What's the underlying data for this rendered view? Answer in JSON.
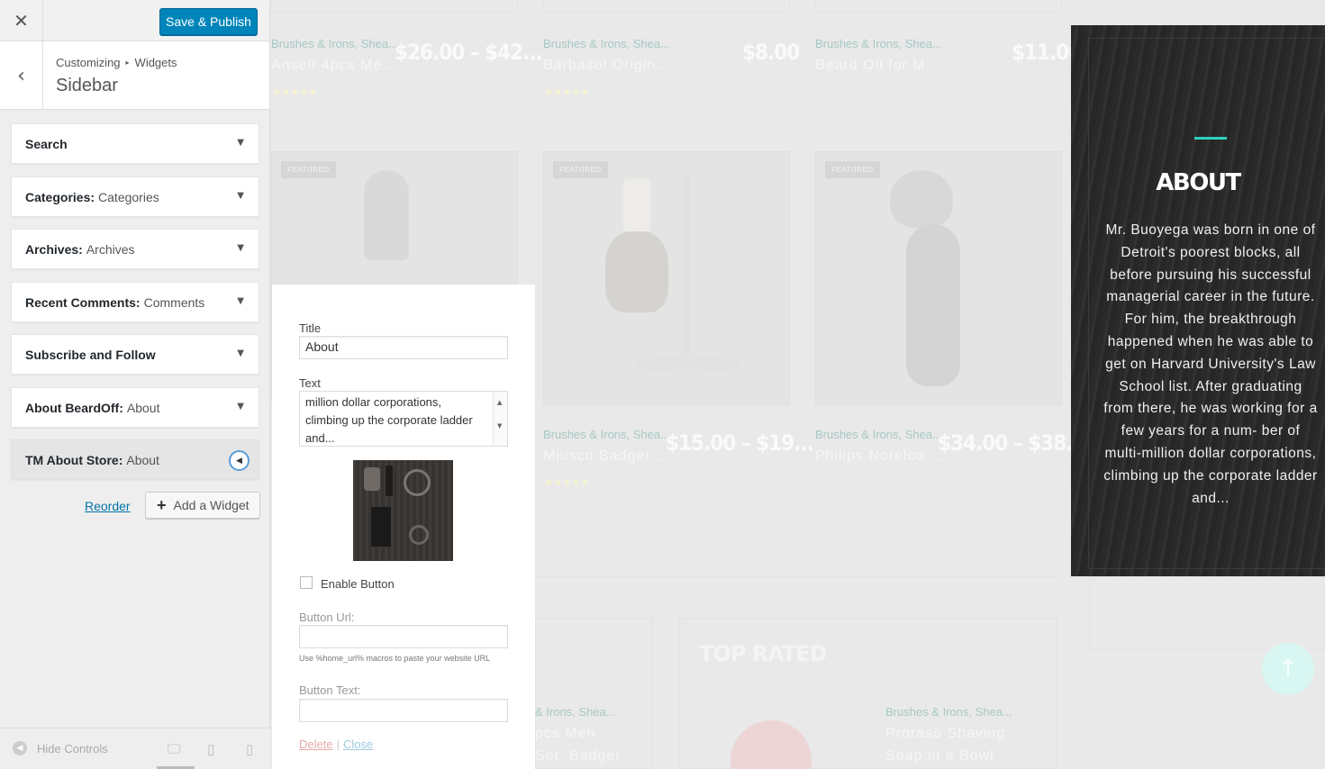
{
  "header": {
    "close_icon": "✕",
    "publish_label": "Save & Publish"
  },
  "section": {
    "back_icon": "‹",
    "crumb_root": "Customizing",
    "crumb_sep": "▸",
    "crumb_child": "Widgets",
    "title": "Sidebar"
  },
  "widgets": [
    {
      "name": "Search",
      "sub": ""
    },
    {
      "name": "Categories:",
      "sub": "Categories"
    },
    {
      "name": "Archives:",
      "sub": "Archives"
    },
    {
      "name": "Recent Comments:",
      "sub": "Comments"
    },
    {
      "name": "Subscribe and Follow",
      "sub": ""
    },
    {
      "name": "About BeardOff:",
      "sub": "About"
    },
    {
      "name": "TM About Store:",
      "sub": "About"
    }
  ],
  "actions": {
    "reorder": "Reorder",
    "add_widget": "Add a Widget"
  },
  "footer": {
    "hide_controls": "Hide Controls"
  },
  "products_row1": [
    {
      "cat": "Brushes & Irons, Shea...",
      "name": "Anself 4pcs Me...",
      "price": "$26.00 – $42...",
      "stars": "★★★★★"
    },
    {
      "cat": "Brushes & Irons, Shea...",
      "name": "Barbasol Origin...",
      "price": "$8.00",
      "stars": "★★★★★"
    },
    {
      "cat": "Brushes & Irons, Shea...",
      "name": "Beard Oil for M...",
      "price": "$11.00",
      "stars": ""
    }
  ],
  "products_row2": [
    {
      "badge": "FEATURED",
      "cat": "",
      "name": "",
      "price": ""
    },
    {
      "badge": "FEATURED",
      "cat": "Brushes & Irons, Shea...",
      "name": "Miusco Badger ...",
      "price": "$15.00 – $19...",
      "stars": "★★★★★"
    },
    {
      "badge": "FEATURED",
      "cat": "Brushes & Irons, Shea...",
      "name": "Philips Norelco ...",
      "price": "$34.00 – $38..."
    }
  ],
  "top_rated": {
    "title": "TOP RATED",
    "items": [
      {
        "cat": "& Irons, Shea...",
        "name1": "pcs Men",
        "name2": "Set, Badger"
      },
      {
        "cat": "Brushes & Irons, Shea...",
        "name1": "Proraso Shaving",
        "name2": "Soap in a Bowl"
      }
    ]
  },
  "scroll_top_icon": "↑",
  "about": {
    "title": "ABOUT",
    "text": "Mr. Buoyega was born in one of Detroit's poorest blocks, all before pursuing his successful managerial career in the future. For him, the breakthrough happened when he was able to get on Harvard University's Law School list. After graduating from there, he was working for a few years for a num- ber of multi-million dollar corporations, climbing up the corporate ladder and..."
  },
  "form": {
    "title_label": "Title",
    "title_value": "About",
    "text_label": "Text",
    "text_value": "million dollar corporations, climbing up the corporate ladder and...",
    "enable_button_label": "Enable Button",
    "button_url_label": "Button Url:",
    "button_url_value": "",
    "hint": "Use %home_url% macros to paste your website URL",
    "button_text_label": "Button Text:",
    "button_text_value": "",
    "delete": "Delete",
    "pipe": "|",
    "close": "Close"
  },
  "colors": {
    "accent": "#0085ba",
    "teal": "#2fd1c0"
  }
}
